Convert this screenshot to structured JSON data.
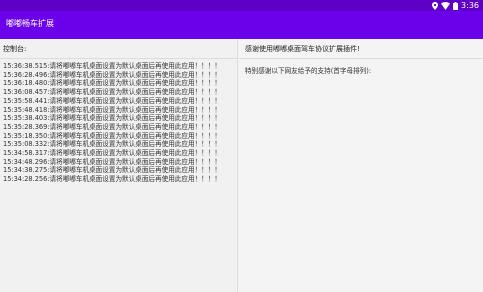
{
  "status_bar": {
    "time": "3:36",
    "icons": [
      "location-icon",
      "wifi-icon",
      "battery-icon"
    ]
  },
  "app_bar": {
    "title": "嘟嘟畅车扩展"
  },
  "console": {
    "header": "控制台:",
    "lines": [
      "15:36:38.515:请将嘟嘟车机桌面设置为默认桌面后再使用此应用！！！！",
      "15:36:28.496:请将嘟嘟车机桌面设置为默认桌面后再使用此应用！！！！",
      "15:36:18.480:请将嘟嘟车机桌面设置为默认桌面后再使用此应用！！！！",
      "15:36:08.457:请将嘟嘟车机桌面设置为默认桌面后再使用此应用！！！！",
      "15:35:58.441:请将嘟嘟车机桌面设置为默认桌面后再使用此应用！！！！",
      "15:35:48.418:请将嘟嘟车机桌面设置为默认桌面后再使用此应用！！！！",
      "15:35:38.403:请将嘟嘟车机桌面设置为默认桌面后再使用此应用！！！！",
      "15:35:28.369:请将嘟嘟车机桌面设置为默认桌面后再使用此应用！！！！",
      "15:35:18.350:请将嘟嘟车机桌面设置为默认桌面后再使用此应用！！！！",
      "15:35:08.332:请将嘟嘟车机桌面设置为默认桌面后再使用此应用！！！！",
      "15:34:58.317:请将嘟嘟车机桌面设置为默认桌面后再使用此应用！！！！",
      "15:34:48.296:请将嘟嘟车机桌面设置为默认桌面后再使用此应用！！！！",
      "15:34:38.275:请将嘟嘟车机桌面设置为默认桌面后再使用此应用！！！！",
      "15:34:28.256:请将嘟嘟车机桌面设置为默认桌面后再使用此应用！！！！"
    ]
  },
  "info": {
    "header": "感谢使用嘟嘟桌面驾车协议扩展插件!",
    "thanks": "特别感谢以下网友给予的支持(首字母排列):"
  },
  "colors": {
    "status_bar": "#5e00c6",
    "app_bar": "#6b00ea"
  }
}
